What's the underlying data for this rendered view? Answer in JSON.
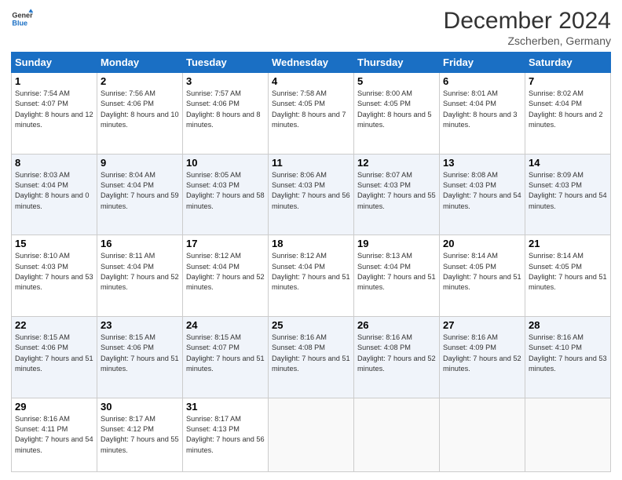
{
  "logo": {
    "line1": "General",
    "line2": "Blue"
  },
  "title": "December 2024",
  "subtitle": "Zscherben, Germany",
  "weekdays": [
    "Sunday",
    "Monday",
    "Tuesday",
    "Wednesday",
    "Thursday",
    "Friday",
    "Saturday"
  ],
  "weeks": [
    [
      {
        "day": "1",
        "sunrise": "7:54 AM",
        "sunset": "4:07 PM",
        "daylight": "8 hours and 12 minutes."
      },
      {
        "day": "2",
        "sunrise": "7:56 AM",
        "sunset": "4:06 PM",
        "daylight": "8 hours and 10 minutes."
      },
      {
        "day": "3",
        "sunrise": "7:57 AM",
        "sunset": "4:06 PM",
        "daylight": "8 hours and 8 minutes."
      },
      {
        "day": "4",
        "sunrise": "7:58 AM",
        "sunset": "4:05 PM",
        "daylight": "8 hours and 7 minutes."
      },
      {
        "day": "5",
        "sunrise": "8:00 AM",
        "sunset": "4:05 PM",
        "daylight": "8 hours and 5 minutes."
      },
      {
        "day": "6",
        "sunrise": "8:01 AM",
        "sunset": "4:04 PM",
        "daylight": "8 hours and 3 minutes."
      },
      {
        "day": "7",
        "sunrise": "8:02 AM",
        "sunset": "4:04 PM",
        "daylight": "8 hours and 2 minutes."
      }
    ],
    [
      {
        "day": "8",
        "sunrise": "8:03 AM",
        "sunset": "4:04 PM",
        "daylight": "8 hours and 0 minutes."
      },
      {
        "day": "9",
        "sunrise": "8:04 AM",
        "sunset": "4:04 PM",
        "daylight": "7 hours and 59 minutes."
      },
      {
        "day": "10",
        "sunrise": "8:05 AM",
        "sunset": "4:03 PM",
        "daylight": "7 hours and 58 minutes."
      },
      {
        "day": "11",
        "sunrise": "8:06 AM",
        "sunset": "4:03 PM",
        "daylight": "7 hours and 56 minutes."
      },
      {
        "day": "12",
        "sunrise": "8:07 AM",
        "sunset": "4:03 PM",
        "daylight": "7 hours and 55 minutes."
      },
      {
        "day": "13",
        "sunrise": "8:08 AM",
        "sunset": "4:03 PM",
        "daylight": "7 hours and 54 minutes."
      },
      {
        "day": "14",
        "sunrise": "8:09 AM",
        "sunset": "4:03 PM",
        "daylight": "7 hours and 54 minutes."
      }
    ],
    [
      {
        "day": "15",
        "sunrise": "8:10 AM",
        "sunset": "4:03 PM",
        "daylight": "7 hours and 53 minutes."
      },
      {
        "day": "16",
        "sunrise": "8:11 AM",
        "sunset": "4:04 PM",
        "daylight": "7 hours and 52 minutes."
      },
      {
        "day": "17",
        "sunrise": "8:12 AM",
        "sunset": "4:04 PM",
        "daylight": "7 hours and 52 minutes."
      },
      {
        "day": "18",
        "sunrise": "8:12 AM",
        "sunset": "4:04 PM",
        "daylight": "7 hours and 51 minutes."
      },
      {
        "day": "19",
        "sunrise": "8:13 AM",
        "sunset": "4:04 PM",
        "daylight": "7 hours and 51 minutes."
      },
      {
        "day": "20",
        "sunrise": "8:14 AM",
        "sunset": "4:05 PM",
        "daylight": "7 hours and 51 minutes."
      },
      {
        "day": "21",
        "sunrise": "8:14 AM",
        "sunset": "4:05 PM",
        "daylight": "7 hours and 51 minutes."
      }
    ],
    [
      {
        "day": "22",
        "sunrise": "8:15 AM",
        "sunset": "4:06 PM",
        "daylight": "7 hours and 51 minutes."
      },
      {
        "day": "23",
        "sunrise": "8:15 AM",
        "sunset": "4:06 PM",
        "daylight": "7 hours and 51 minutes."
      },
      {
        "day": "24",
        "sunrise": "8:15 AM",
        "sunset": "4:07 PM",
        "daylight": "7 hours and 51 minutes."
      },
      {
        "day": "25",
        "sunrise": "8:16 AM",
        "sunset": "4:08 PM",
        "daylight": "7 hours and 51 minutes."
      },
      {
        "day": "26",
        "sunrise": "8:16 AM",
        "sunset": "4:08 PM",
        "daylight": "7 hours and 52 minutes."
      },
      {
        "day": "27",
        "sunrise": "8:16 AM",
        "sunset": "4:09 PM",
        "daylight": "7 hours and 52 minutes."
      },
      {
        "day": "28",
        "sunrise": "8:16 AM",
        "sunset": "4:10 PM",
        "daylight": "7 hours and 53 minutes."
      }
    ],
    [
      {
        "day": "29",
        "sunrise": "8:16 AM",
        "sunset": "4:11 PM",
        "daylight": "7 hours and 54 minutes."
      },
      {
        "day": "30",
        "sunrise": "8:17 AM",
        "sunset": "4:12 PM",
        "daylight": "7 hours and 55 minutes."
      },
      {
        "day": "31",
        "sunrise": "8:17 AM",
        "sunset": "4:13 PM",
        "daylight": "7 hours and 56 minutes."
      },
      null,
      null,
      null,
      null
    ]
  ]
}
